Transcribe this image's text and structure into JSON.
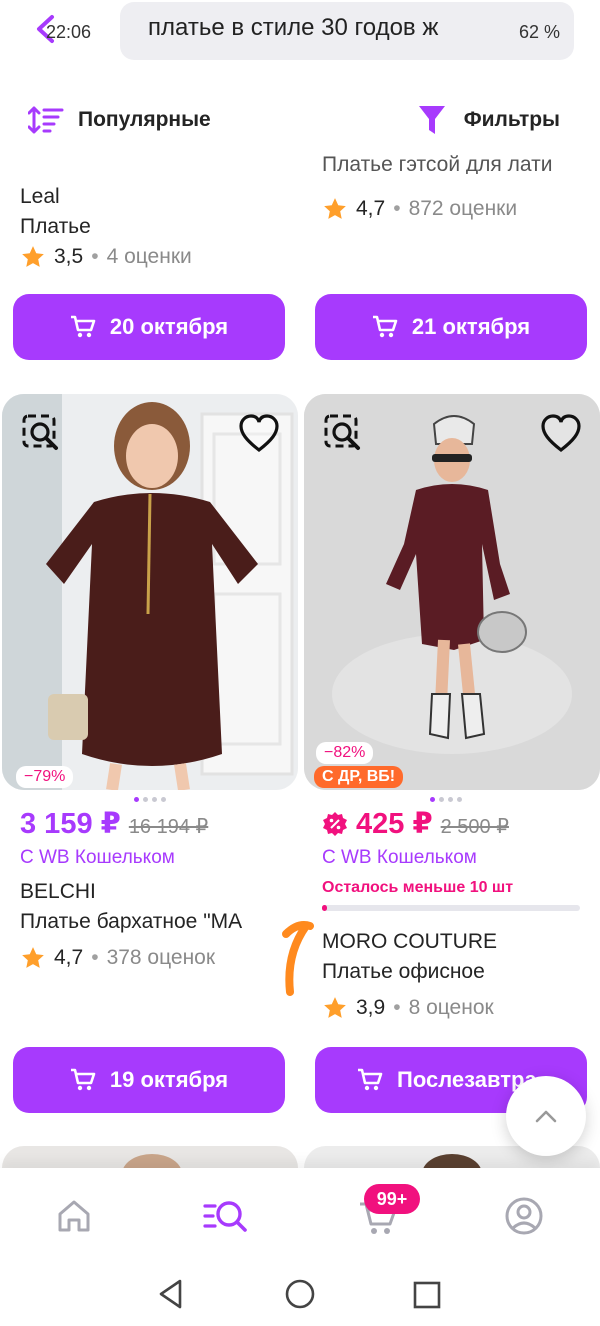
{
  "status_bar": {
    "time": "22:06",
    "battery": "62 %"
  },
  "search": {
    "query": "платье в стиле 30 годов ж"
  },
  "toolbar": {
    "sort_label": "Популярные",
    "filter_label": "Фильтры"
  },
  "top_row": [
    {
      "brand": "Leal",
      "title": "Платье",
      "rating": "3,5",
      "reviews": "4 оценки",
      "cart_label": "20 октября"
    },
    {
      "title_partial": "Платье гэтсой для лати",
      "rating": "4,7",
      "reviews": "872 оценки",
      "cart_label": "21 октября"
    }
  ],
  "products": [
    {
      "discount_badge": "−79%",
      "price": "3 159 ₽",
      "old_price": "16 194 ₽",
      "wallet": "С WB Кошельком",
      "brand": "BELCHI",
      "title": "Платье бархатное \"МА",
      "rating": "4,7",
      "reviews": "378 оценок",
      "cart_label": "19 октября"
    },
    {
      "discount_badge": "−82%",
      "promo_badge": "С ДР, ВБ!",
      "price": "425 ₽",
      "old_price": "2 500 ₽",
      "wallet": "С WB Кошельком",
      "stock_text": "Осталось меньше 10 шт",
      "stock_level": 0.02,
      "brand": "MORO COUTURE",
      "title": "Платье офисное",
      "rating": "3,9",
      "reviews": "8 оценок",
      "cart_label": "Послезавтра"
    }
  ],
  "bottom_nav": {
    "items": [
      "home-icon",
      "catalog-search-icon",
      "cart-icon",
      "profile-icon"
    ],
    "cart_badge": "99+"
  },
  "colors": {
    "accent": "#a73afd",
    "pink": "#f1117e"
  }
}
